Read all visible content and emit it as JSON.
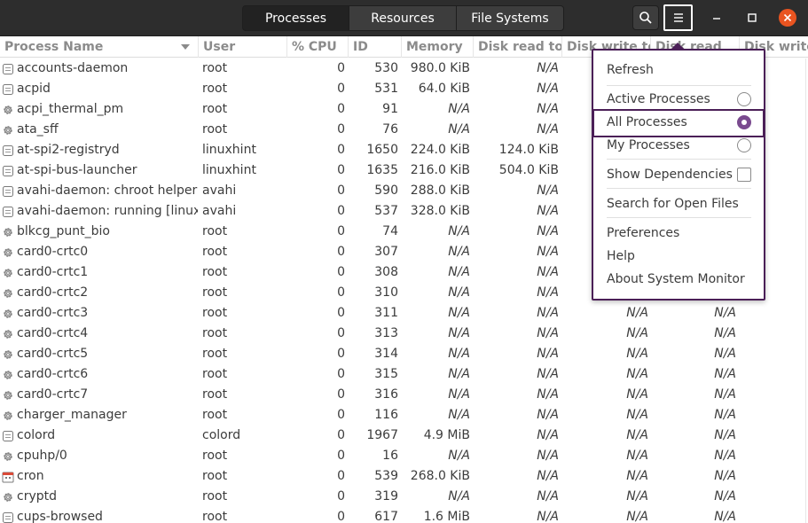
{
  "tabs": [
    {
      "label": "Processes"
    },
    {
      "label": "Resources"
    },
    {
      "label": "File Systems"
    }
  ],
  "header_icons": {
    "search": "search-icon",
    "menu": "hamburger-menu-icon",
    "minimize": "minimize-icon",
    "maximize": "maximize-icon",
    "close": "close-icon"
  },
  "columns": [
    "Process Name",
    "User",
    "% CPU",
    "ID",
    "Memory",
    "Disk read tota",
    "Disk write tot",
    "Disk read",
    "Disk write"
  ],
  "rows": [
    {
      "icon": "doc",
      "name": "accounts-daemon",
      "user": "root",
      "cpu": "0",
      "id": "530",
      "mem": "980.0 KiB",
      "dr": "N/A",
      "dw": "",
      "dr2": "",
      "dw2": ""
    },
    {
      "icon": "doc",
      "name": "acpid",
      "user": "root",
      "cpu": "0",
      "id": "531",
      "mem": "64.0 KiB",
      "dr": "N/A",
      "dw": "",
      "dr2": "",
      "dw2": ""
    },
    {
      "icon": "gear",
      "name": "acpi_thermal_pm",
      "user": "root",
      "cpu": "0",
      "id": "91",
      "mem": "N/A",
      "dr": "N/A",
      "dw": "",
      "dr2": "",
      "dw2": ""
    },
    {
      "icon": "gear",
      "name": "ata_sff",
      "user": "root",
      "cpu": "0",
      "id": "76",
      "mem": "N/A",
      "dr": "N/A",
      "dw": "",
      "dr2": "",
      "dw2": ""
    },
    {
      "icon": "doc",
      "name": "at-spi2-registryd",
      "user": "linuxhint",
      "cpu": "0",
      "id": "1650",
      "mem": "224.0 KiB",
      "dr": "124.0 KiB",
      "dw": "",
      "dr2": "",
      "dw2": ""
    },
    {
      "icon": "doc",
      "name": "at-spi-bus-launcher",
      "user": "linuxhint",
      "cpu": "0",
      "id": "1635",
      "mem": "216.0 KiB",
      "dr": "504.0 KiB",
      "dw": "",
      "dr2": "",
      "dw2": ""
    },
    {
      "icon": "doc",
      "name": "avahi-daemon: chroot helper",
      "user": "avahi",
      "cpu": "0",
      "id": "590",
      "mem": "288.0 KiB",
      "dr": "N/A",
      "dw": "",
      "dr2": "",
      "dw2": ""
    },
    {
      "icon": "doc",
      "name": "avahi-daemon: running [linuxhint",
      "user": "avahi",
      "cpu": "0",
      "id": "537",
      "mem": "328.0 KiB",
      "dr": "N/A",
      "dw": "",
      "dr2": "",
      "dw2": ""
    },
    {
      "icon": "gear",
      "name": "blkcg_punt_bio",
      "user": "root",
      "cpu": "0",
      "id": "74",
      "mem": "N/A",
      "dr": "N/A",
      "dw": "",
      "dr2": "",
      "dw2": ""
    },
    {
      "icon": "gear",
      "name": "card0-crtc0",
      "user": "root",
      "cpu": "0",
      "id": "307",
      "mem": "N/A",
      "dr": "N/A",
      "dw": "",
      "dr2": "",
      "dw2": ""
    },
    {
      "icon": "gear",
      "name": "card0-crtc1",
      "user": "root",
      "cpu": "0",
      "id": "308",
      "mem": "N/A",
      "dr": "N/A",
      "dw": "",
      "dr2": "",
      "dw2": ""
    },
    {
      "icon": "gear",
      "name": "card0-crtc2",
      "user": "root",
      "cpu": "0",
      "id": "310",
      "mem": "N/A",
      "dr": "N/A",
      "dw": "",
      "dr2": "",
      "dw2": ""
    },
    {
      "icon": "gear",
      "name": "card0-crtc3",
      "user": "root",
      "cpu": "0",
      "id": "311",
      "mem": "N/A",
      "dr": "N/A",
      "dw": "N/A",
      "dr2": "N/A",
      "dw2": ""
    },
    {
      "icon": "gear",
      "name": "card0-crtc4",
      "user": "root",
      "cpu": "0",
      "id": "313",
      "mem": "N/A",
      "dr": "N/A",
      "dw": "N/A",
      "dr2": "N/A",
      "dw2": ""
    },
    {
      "icon": "gear",
      "name": "card0-crtc5",
      "user": "root",
      "cpu": "0",
      "id": "314",
      "mem": "N/A",
      "dr": "N/A",
      "dw": "N/A",
      "dr2": "N/A",
      "dw2": ""
    },
    {
      "icon": "gear",
      "name": "card0-crtc6",
      "user": "root",
      "cpu": "0",
      "id": "315",
      "mem": "N/A",
      "dr": "N/A",
      "dw": "N/A",
      "dr2": "N/A",
      "dw2": ""
    },
    {
      "icon": "gear",
      "name": "card0-crtc7",
      "user": "root",
      "cpu": "0",
      "id": "316",
      "mem": "N/A",
      "dr": "N/A",
      "dw": "N/A",
      "dr2": "N/A",
      "dw2": ""
    },
    {
      "icon": "gear",
      "name": "charger_manager",
      "user": "root",
      "cpu": "0",
      "id": "116",
      "mem": "N/A",
      "dr": "N/A",
      "dw": "N/A",
      "dr2": "N/A",
      "dw2": ""
    },
    {
      "icon": "doc",
      "name": "colord",
      "user": "colord",
      "cpu": "0",
      "id": "1967",
      "mem": "4.9 MiB",
      "dr": "N/A",
      "dw": "N/A",
      "dr2": "N/A",
      "dw2": ""
    },
    {
      "icon": "gear",
      "name": "cpuhp/0",
      "user": "root",
      "cpu": "0",
      "id": "16",
      "mem": "N/A",
      "dr": "N/A",
      "dw": "N/A",
      "dr2": "N/A",
      "dw2": ""
    },
    {
      "icon": "cal",
      "name": "cron",
      "user": "root",
      "cpu": "0",
      "id": "539",
      "mem": "268.0 KiB",
      "dr": "N/A",
      "dw": "N/A",
      "dr2": "N/A",
      "dw2": ""
    },
    {
      "icon": "gear",
      "name": "cryptd",
      "user": "root",
      "cpu": "0",
      "id": "319",
      "mem": "N/A",
      "dr": "N/A",
      "dw": "N/A",
      "dr2": "N/A",
      "dw2": ""
    },
    {
      "icon": "doc",
      "name": "cups-browsed",
      "user": "root",
      "cpu": "0",
      "id": "617",
      "mem": "1.6 MiB",
      "dr": "N/A",
      "dw": "N/A",
      "dr2": "N/A",
      "dw2": ""
    }
  ],
  "menu": {
    "refresh": "Refresh",
    "active": "Active Processes",
    "all": "All Processes",
    "mine": "My Processes",
    "deps": "Show Dependencies",
    "search": "Search for Open Files",
    "prefs": "Preferences",
    "help": "Help",
    "about": "About System Monitor",
    "selected": "All Processes"
  },
  "colors": {
    "accent": "#7a4a8f",
    "highlight_border": "#4b1f57",
    "close": "#e95420",
    "headerbar": "#2d2d2d"
  }
}
